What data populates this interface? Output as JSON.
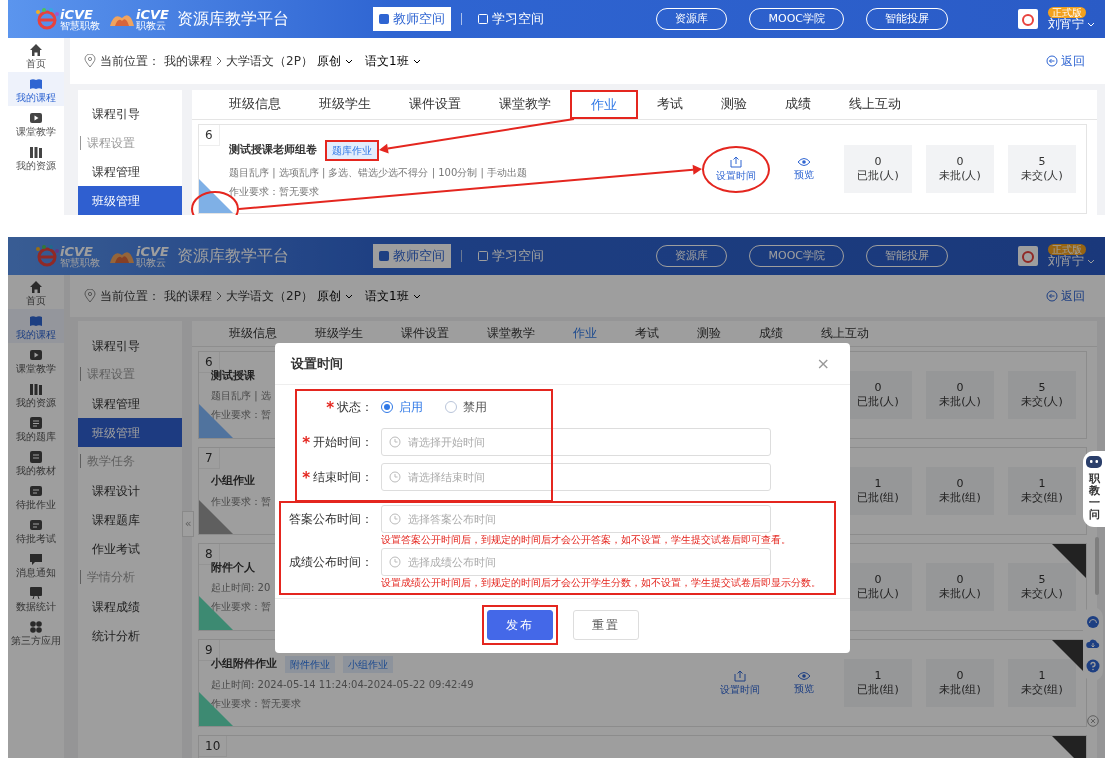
{
  "screens": [
    {
      "header": {
        "logo_1": {
          "brand": "iCVE",
          "sub": "智慧职教"
        },
        "logo_2": {
          "brand": "iCVE",
          "sub": "职教云"
        },
        "title": "资源库教学平台",
        "spaces": [
          {
            "label": "教师空间",
            "selected": true
          },
          {
            "label": "学习空间",
            "selected": false
          }
        ],
        "links": [
          "资源库",
          "MOOC学院",
          "智能投屏"
        ],
        "badge": "正式版",
        "user": "刘宵宁"
      },
      "rail": [
        {
          "label": "首页",
          "selected": false
        },
        {
          "label": "我的课程",
          "selected": true
        },
        {
          "label": "课堂教学",
          "selected": false
        },
        {
          "label": "我的资源",
          "selected": false
        }
      ],
      "breadcrumb": {
        "label": "当前位置：",
        "root": "我的课程",
        "course": "大学语文（2P）",
        "course_type": "原创",
        "class_name": "语文1班"
      },
      "back": "返回",
      "menu": [
        {
          "kind": "item",
          "label": "课程引导",
          "selected": false
        },
        {
          "kind": "section",
          "label": "课程设置",
          "selected": false
        },
        {
          "kind": "item",
          "label": "课程管理",
          "selected": false
        },
        {
          "kind": "item",
          "label": "班级管理",
          "selected": true
        }
      ],
      "tabs": [
        {
          "label": "班级信息",
          "selected": false,
          "annotated": false
        },
        {
          "label": "班级学生",
          "selected": false,
          "annotated": false
        },
        {
          "label": "课件设置",
          "selected": false,
          "annotated": false
        },
        {
          "label": "课堂教学",
          "selected": false,
          "annotated": false
        },
        {
          "label": "作业",
          "selected": true,
          "annotated": true
        },
        {
          "label": "考试",
          "selected": false,
          "annotated": false
        },
        {
          "label": "测验",
          "selected": false,
          "annotated": false
        },
        {
          "label": "成绩",
          "selected": false,
          "annotated": false
        },
        {
          "label": "线上互动",
          "selected": false,
          "annotated": false
        }
      ],
      "assignments": [
        {
          "number": "6",
          "title": "测试授课老师组卷",
          "tags": [
            {
              "label": "题库作业",
              "annotated": true
            }
          ],
          "meta": "题目乱序 | 选项乱序 | 多选、错选少选不得分 | 100分制 | 手动出题",
          "requirement": "作业要求：暂无要求",
          "actions": [
            {
              "label": "设置时间",
              "circled": true
            },
            {
              "label": "预览",
              "circled": false
            }
          ],
          "stats": [
            {
              "value": "0",
              "label": "已批(人)"
            },
            {
              "value": "0",
              "label": "未批(人)"
            },
            {
              "value": "5",
              "label": "未交(人)"
            }
          ],
          "ribbon": {
            "color": "#7fb0e6",
            "circled": true
          }
        }
      ]
    },
    {
      "header": {
        "logo_1": {
          "brand": "iCVE",
          "sub": "智慧职教"
        },
        "logo_2": {
          "brand": "iCVE",
          "sub": "职教云"
        },
        "title": "资源库教学平台",
        "spaces": [
          {
            "label": "教师空间",
            "selected": true
          },
          {
            "label": "学习空间",
            "selected": false
          }
        ],
        "links": [
          "资源库",
          "MOOC学院",
          "智能投屏"
        ],
        "badge": "正式版",
        "user": "刘宵宁"
      },
      "rail": [
        {
          "label": "首页",
          "selected": false
        },
        {
          "label": "我的课程",
          "selected": true
        },
        {
          "label": "课堂教学",
          "selected": false
        },
        {
          "label": "我的资源",
          "selected": false
        },
        {
          "label": "我的题库",
          "selected": false
        },
        {
          "label": "我的教材",
          "selected": false
        },
        {
          "label": "待批作业",
          "selected": false
        },
        {
          "label": "待批考试",
          "selected": false
        },
        {
          "label": "消息通知",
          "selected": false
        },
        {
          "label": "数据统计",
          "selected": false
        },
        {
          "label": "第三方应用",
          "selected": false
        }
      ],
      "breadcrumb": {
        "label": "当前位置：",
        "root": "我的课程",
        "course": "大学语文（2P）",
        "course_type": "原创",
        "class_name": "语文1班"
      },
      "back": "返回",
      "menu": [
        {
          "kind": "item",
          "label": "课程引导",
          "selected": false
        },
        {
          "kind": "section",
          "label": "课程设置",
          "selected": false
        },
        {
          "kind": "item",
          "label": "课程管理",
          "selected": false
        },
        {
          "kind": "item",
          "label": "班级管理",
          "selected": true
        },
        {
          "kind": "section",
          "label": "教学任务",
          "selected": false
        },
        {
          "kind": "item",
          "label": "课程设计",
          "selected": false
        },
        {
          "kind": "item",
          "label": "课程题库",
          "selected": false
        },
        {
          "kind": "item",
          "label": "作业考试",
          "selected": false
        },
        {
          "kind": "section",
          "label": "学情分析",
          "selected": false
        },
        {
          "kind": "item",
          "label": "课程成绩",
          "selected": false
        },
        {
          "kind": "item",
          "label": "统计分析",
          "selected": false
        }
      ],
      "collapse_toggle": "«",
      "tabs": [
        {
          "label": "班级信息",
          "selected": false
        },
        {
          "label": "班级学生",
          "selected": false
        },
        {
          "label": "课件设置",
          "selected": false
        },
        {
          "label": "课堂教学",
          "selected": false
        },
        {
          "label": "作业",
          "selected": true
        },
        {
          "label": "考试",
          "selected": false
        },
        {
          "label": "测验",
          "selected": false
        },
        {
          "label": "成绩",
          "selected": false
        },
        {
          "label": "线上互动",
          "selected": false
        }
      ],
      "assignments": [
        {
          "number": "6",
          "title": "测试授课",
          "meta": "题目乱序 | 选",
          "requirement": "作业要求：暂",
          "stats": [
            {
              "value": "0",
              "label": "已批(人)"
            },
            {
              "value": "0",
              "label": "未批(人)"
            },
            {
              "value": "5",
              "label": "未交(人)"
            }
          ],
          "ribbon": {
            "color": "#50739e"
          }
        },
        {
          "number": "7",
          "title": "小组作业",
          "requirement": "作业要求：暂",
          "stats": [
            {
              "value": "1",
              "label": "已批(组)"
            },
            {
              "value": "0",
              "label": "未批(组)"
            },
            {
              "value": "1",
              "label": "未交(组)"
            }
          ],
          "ribbon": {
            "color": "#5f5f5f"
          }
        },
        {
          "number": "8",
          "title": "附件个人",
          "meta": "起止时间: 20",
          "requirement": "作业要求：暂",
          "stats": [
            {
              "value": "0",
              "label": "已批(人)"
            },
            {
              "value": "0",
              "label": "未批(人)"
            },
            {
              "value": "5",
              "label": "未交(人)"
            }
          ],
          "ribbon": {
            "color": "#3d8a72"
          },
          "end_ribbon": {
            "color": "#222222"
          }
        },
        {
          "number": "9",
          "title": "小组附件作业",
          "tags": [
            {
              "label": "附件作业"
            },
            {
              "label": "小组作业"
            }
          ],
          "meta": "起止时间: 2024-05-14 11:24:04-2024-05-22 09:42:49",
          "requirement": "作业要求：暂无要求",
          "actions": [
            {
              "label": "设置时间"
            },
            {
              "label": "预览"
            }
          ],
          "stats": [
            {
              "value": "1",
              "label": "已批(组)"
            },
            {
              "value": "0",
              "label": "未批(组)"
            },
            {
              "value": "1",
              "label": "未交(组)"
            }
          ],
          "ribbon": {
            "color": "#3d8a72"
          },
          "end_ribbon": {
            "color": "#222222"
          }
        },
        {
          "number": "10",
          "end_ribbon": {
            "color": "#222222"
          }
        }
      ],
      "assistant": {
        "label": "职教一问"
      },
      "dialog": {
        "title": "设置时间",
        "close": "×",
        "groups": [
          {
            "annotated": true,
            "fields": [
              {
                "kind": "radio",
                "label": "状态：",
                "required_mark": "*",
                "options": [
                  {
                    "label": "启用",
                    "selected": true
                  },
                  {
                    "label": "禁用",
                    "selected": false
                  }
                ]
              },
              {
                "kind": "time",
                "label": "开始时间：",
                "required_mark": "*",
                "placeholder": "请选择开始时间"
              },
              {
                "kind": "time",
                "label": "结束时间：",
                "required_mark": "*",
                "placeholder": "请选择结束时间"
              }
            ]
          },
          {
            "annotated": true,
            "fields": [
              {
                "kind": "time",
                "label": "答案公布时间：",
                "placeholder": "选择答案公布时间",
                "hint": "设置答案公开时间后，到规定的时间后才会公开答案，如不设置，学生提交试卷后即可查看。"
              },
              {
                "kind": "time",
                "label": "成绩公布时间：",
                "placeholder": "选择成绩公布时间",
                "hint": "设置成绩公开时间后，到规定的时间后才会公开学生分数，如不设置，学生提交试卷后即显示分数。"
              }
            ]
          }
        ],
        "buttons": [
          {
            "kind": "primary",
            "label": "发布",
            "annotated": true
          },
          {
            "kind": "secondary",
            "label": "重置",
            "annotated": false
          }
        ]
      }
    }
  ]
}
